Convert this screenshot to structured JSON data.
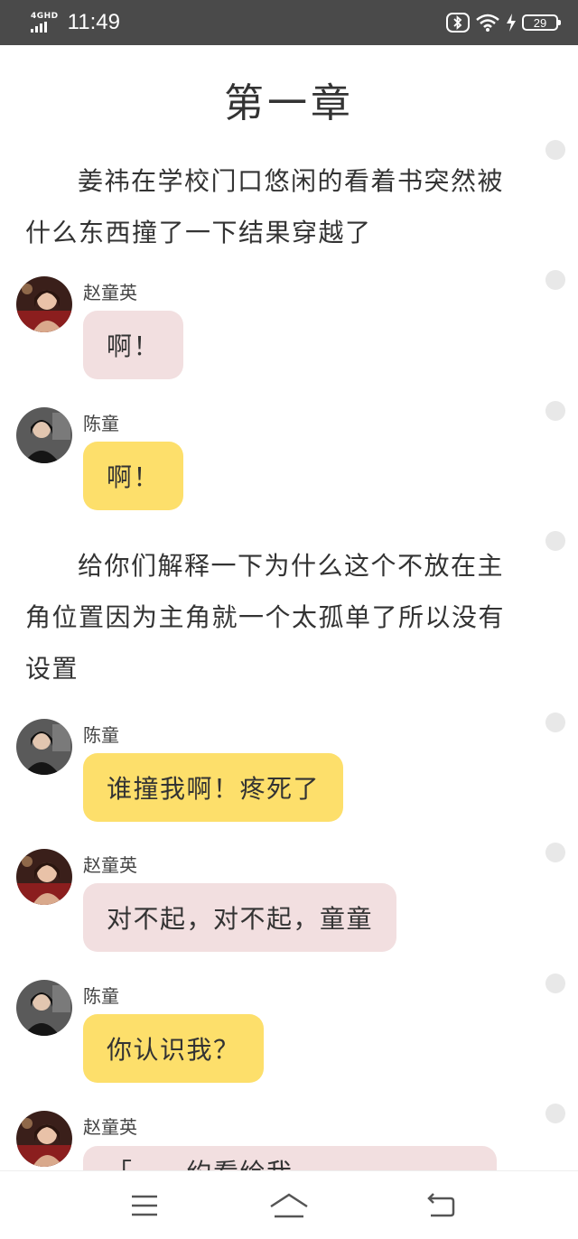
{
  "status_bar": {
    "network_type": "4GHD",
    "time": "11:49",
    "battery": "29",
    "icons": [
      "signal-icon",
      "bluetooth-icon",
      "wifi-icon",
      "charging-icon",
      "battery-icon"
    ]
  },
  "chapter_title": "第一章",
  "narrations": [
    "姜祎在学校门口悠闲的看着书突然被什么东西撞了一下结果穿越了",
    "给你们解释一下为什么这个不放在主角位置因为主角就一个太孤单了所以没有设置"
  ],
  "messages": [
    {
      "sender": "赵童英",
      "text": "啊！"
    },
    {
      "sender": "陈童",
      "text": "啊！"
    },
    {
      "sender": "陈童",
      "text": "谁撞我啊！疼死了"
    },
    {
      "sender": "赵童英",
      "text": "对不起，对不起，童童"
    },
    {
      "sender": "陈童",
      "text": "你认识我？"
    },
    {
      "sender": "赵童英",
      "text": "「……约看绘我，一…"
    }
  ],
  "colors": {
    "status_bar_bg": "#4a4a4a",
    "bubble_zhao": "#f2dfe0",
    "bubble_chen": "#fddf6b",
    "dot": "#e8e8e8"
  },
  "nav_bar": {
    "icons": [
      "menu-icon",
      "home-icon",
      "back-icon"
    ]
  }
}
